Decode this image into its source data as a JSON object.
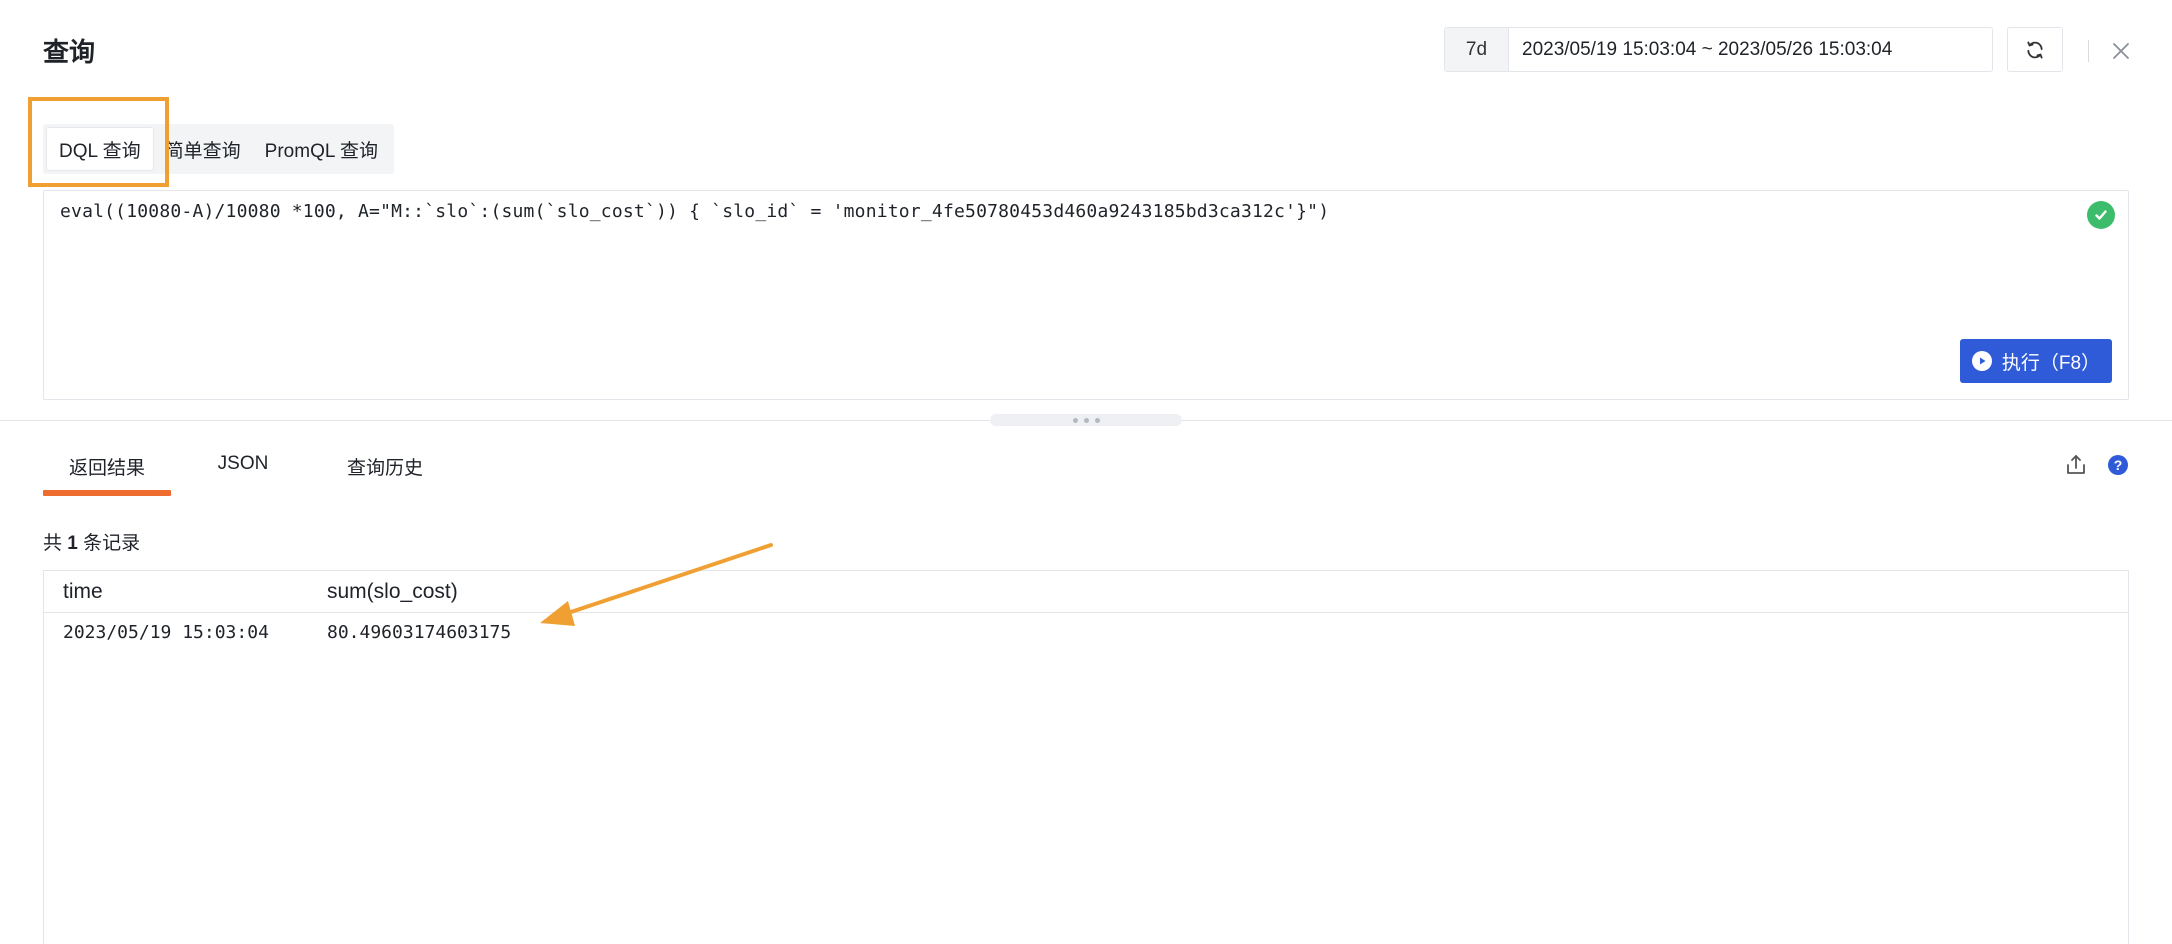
{
  "header": {
    "title": "查询",
    "time_preset": "7d",
    "time_range": "2023/05/19 15:03:04 ~ 2023/05/26 15:03:04"
  },
  "query_tabs": [
    {
      "label": "DQL 查询",
      "active": true
    },
    {
      "label": "简单查询",
      "active": false
    },
    {
      "label": "PromQL 查询",
      "active": false
    }
  ],
  "editor": {
    "code": "eval((10080-A)/10080 *100, A=\"M::`slo`:(sum(`slo_cost`)) { `slo_id` = 'monitor_4fe50780453d460a9243185bd3ca312c'}\")",
    "run_label": "执行（F8）"
  },
  "result_tabs": [
    {
      "label": "返回结果",
      "active": true
    },
    {
      "label": "JSON",
      "active": false
    },
    {
      "label": "查询历史",
      "active": false
    }
  ],
  "records": {
    "prefix": "共",
    "count": "1",
    "suffix": "条记录"
  },
  "table": {
    "columns": [
      "time",
      "sum(slo_cost)"
    ],
    "rows": [
      [
        "2023/05/19 15:03:04",
        "80.49603174603175"
      ]
    ]
  },
  "icons": {
    "refresh": "refresh-icon",
    "close": "close-icon",
    "valid": "check-circle-icon",
    "run": "play-icon",
    "export": "export-icon",
    "help": "help-icon"
  },
  "colors": {
    "primary": "#2f5bd8",
    "active_tab_underline": "#ee6c2f",
    "annotation": "#f0a033",
    "valid": "#3dbd6b"
  }
}
